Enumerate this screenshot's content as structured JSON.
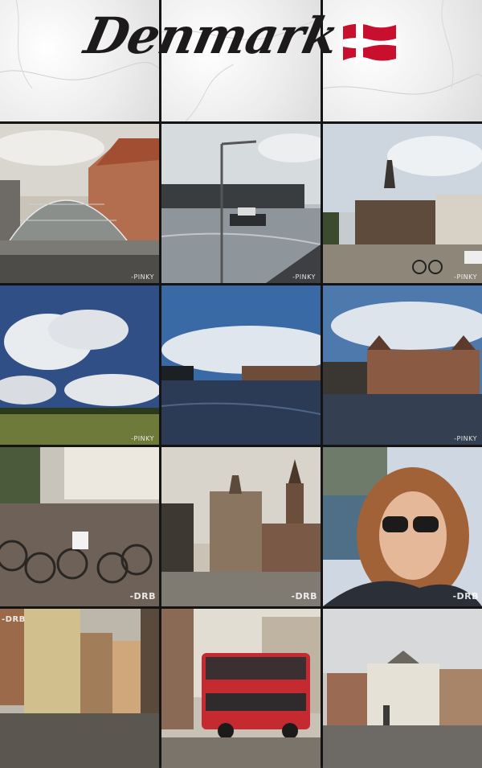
{
  "header": {
    "title": "Denmark",
    "flag_icon": "denmark-flag-icon"
  },
  "watermarks": {
    "small": "-PINKY",
    "drb": "-DRB"
  },
  "colors": {
    "background": "#141414",
    "flag_red": "#c8102e",
    "title_ink": "#1c1a1a"
  }
}
